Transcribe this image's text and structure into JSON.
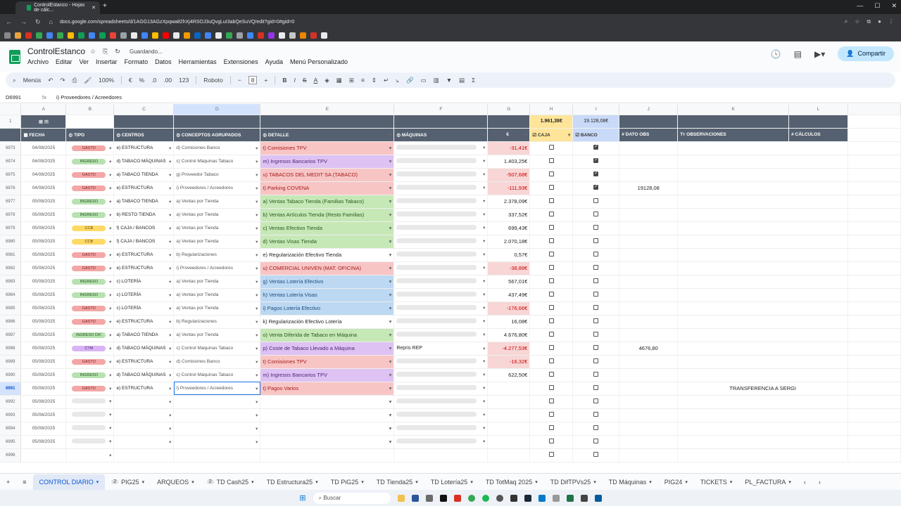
{
  "browser": {
    "tab_title": "ControlEstanco - Hojas de cálc...",
    "url": "docs.google.com/spreadsheets/d/1AGG13AGzXpqwa82hXj4RSOJ3uQvgLuI3abQeSuVQ/edit?gid=0#gid=0"
  },
  "doc": {
    "title": "ControlEstanco",
    "saving": "Guardando...",
    "menu": [
      "Archivo",
      "Editar",
      "Ver",
      "Insertar",
      "Formato",
      "Datos",
      "Herramientas",
      "Extensiones",
      "Ayuda",
      "Menú Personalizado"
    ],
    "share": "Compartir"
  },
  "toolbar": {
    "menus": "Menús",
    "zoom": "100%",
    "currency": "€",
    "percent": "%",
    "dec_less": ".0",
    "dec_more": ".00",
    "num": "123",
    "font": "Roboto",
    "font_size": "8",
    "sigma": "Σ"
  },
  "formula": {
    "ref": "D6991",
    "value": "i) Proveedores / Acreedores"
  },
  "columns": [
    "A",
    "B",
    "C",
    "D",
    "E",
    "F",
    "G",
    "H",
    "I",
    "J",
    "K",
    "L"
  ],
  "totals": {
    "caja": "1.961,38€",
    "banco": "19.128,08€"
  },
  "headers": {
    "fecha": "FECHA",
    "tipo": "TIPO",
    "centros": "CENTROS",
    "conceptos": "CONCEPTOS AGRUPADOS",
    "detalle": "DETALLE",
    "maquinas": "MÁQUINAS",
    "euro": "€",
    "caja": "CAJA",
    "banco": "BANCO",
    "dato_obs": "DATO OBS",
    "observaciones": "OBSERVACIONES",
    "calculos": "CÁLCULOS"
  },
  "rows": [
    {
      "n": "6973",
      "fecha": "04/08/2025",
      "tipo": "GASTO",
      "tc": "gasto",
      "centro": "e) ESTRUCTURA",
      "concepto": "d) Comisiones Banco",
      "detalle": "t) Comisiones TPV",
      "dc": "det-red",
      "maq": "",
      "euro": "-31,41€",
      "neg": true,
      "caja": false,
      "banco": true,
      "obs": "",
      "dato": ""
    },
    {
      "n": "6974",
      "fecha": "04/08/2025",
      "tipo": "INGRESO",
      "tc": "ingreso",
      "centro": "d) TABACO MÁQUINAS",
      "concepto": "c) Control Máquinas Tabaco",
      "detalle": "m) Ingresos Bancarios TPV",
      "dc": "det-purple",
      "maq": "",
      "euro": "1.403,25€",
      "neg": false,
      "caja": false,
      "banco": true,
      "obs": "",
      "dato": ""
    },
    {
      "n": "6975",
      "fecha": "04/08/2025",
      "tipo": "GASTO",
      "tc": "gasto",
      "centro": "a) TABACO TIENDA",
      "concepto": "g) Proveedor Tabaco",
      "detalle": "u) TABACOS DEL MEDIT SA (TABACO)",
      "dc": "det-red",
      "maq": "",
      "euro": "-507,68€",
      "neg": true,
      "caja": false,
      "banco": true,
      "obs": "",
      "dato": ""
    },
    {
      "n": "6976",
      "fecha": "04/08/2025",
      "tipo": "GASTO",
      "tc": "gasto",
      "centro": "e) ESTRUCTURA",
      "concepto": "i) Proveedores / Acreedores",
      "detalle": "t) Parking COVENA",
      "dc": "det-red",
      "maq": "",
      "euro": "-111,93€",
      "neg": true,
      "caja": false,
      "banco": true,
      "obs": "",
      "dato": "19128,08"
    },
    {
      "n": "6977",
      "fecha": "05/08/2025",
      "tipo": "INGRESO",
      "tc": "ingreso",
      "centro": "a) TABACO TIENDA",
      "concepto": "a) Ventas por Tienda",
      "detalle": "a) Ventas Tabaco Tienda (Familias Tabaco)",
      "dc": "det-green",
      "maq": "",
      "euro": "2.378,09€",
      "neg": false,
      "caja": false,
      "banco": false,
      "obs": "",
      "dato": ""
    },
    {
      "n": "6978",
      "fecha": "05/08/2025",
      "tipo": "INGRESO",
      "tc": "ingreso",
      "centro": "b) RESTO TIENDA",
      "concepto": "a) Ventas por Tienda",
      "detalle": "b) Ventas Artículos Tienda (Resto Familias)",
      "dc": "det-green",
      "maq": "",
      "euro": "337,52€",
      "neg": false,
      "caja": false,
      "banco": false,
      "obs": "",
      "dato": ""
    },
    {
      "n": "6979",
      "fecha": "05/08/2025",
      "tipo": "CCB",
      "tc": "ccb",
      "centro": "f) CAJA / BANCOS",
      "concepto": "a) Ventas por Tienda",
      "detalle": "c) Ventas Efectivo Tienda",
      "dc": "det-green",
      "maq": "",
      "euro": "699,43€",
      "neg": false,
      "caja": false,
      "banco": false,
      "obs": "",
      "dato": ""
    },
    {
      "n": "6980",
      "fecha": "05/08/2025",
      "tipo": "CCB",
      "tc": "ccb",
      "centro": "f) CAJA / BANCOS",
      "concepto": "a) Ventas por Tienda",
      "detalle": "d) Ventas Visas Tienda",
      "dc": "det-green",
      "maq": "",
      "euro": "2.070,18€",
      "neg": false,
      "caja": false,
      "banco": false,
      "obs": "",
      "dato": ""
    },
    {
      "n": "6981",
      "fecha": "05/08/2025",
      "tipo": "GASTO",
      "tc": "gasto",
      "centro": "e) ESTRUCTURA",
      "concepto": "b) Regularizaciones",
      "detalle": "e) Regularización Efectivo Tienda",
      "dc": "",
      "maq": "",
      "euro": "0,57€",
      "neg": false,
      "caja": false,
      "banco": false,
      "obs": "",
      "dato": ""
    },
    {
      "n": "6982",
      "fecha": "05/08/2025",
      "tipo": "GASTO",
      "tc": "gasto",
      "centro": "e) ESTRUCTURA",
      "concepto": "i) Proveedores / Acreedores",
      "detalle": "u) COMERCIAL UNIVEN (MAT. OFICINA)",
      "dc": "det-red",
      "maq": "",
      "euro": "-38,88€",
      "neg": true,
      "caja": false,
      "banco": false,
      "obs": "",
      "dato": ""
    },
    {
      "n": "6983",
      "fecha": "05/08/2025",
      "tipo": "INGRESO",
      "tc": "ingreso",
      "centro": "c) LOTERÍA",
      "concepto": "a) Ventas por Tienda",
      "detalle": "g) Ventas Lotería Efectivo",
      "dc": "det-blue",
      "maq": "",
      "euro": "567,01€",
      "neg": false,
      "caja": false,
      "banco": false,
      "obs": "",
      "dato": ""
    },
    {
      "n": "6984",
      "fecha": "05/08/2025",
      "tipo": "INGRESO",
      "tc": "ingreso",
      "centro": "c) LOTERÍA",
      "concepto": "a) Ventas por Tienda",
      "detalle": "h) Ventas Lotería Visas",
      "dc": "det-blue",
      "maq": "",
      "euro": "437,49€",
      "neg": false,
      "caja": false,
      "banco": false,
      "obs": "",
      "dato": ""
    },
    {
      "n": "6985",
      "fecha": "05/08/2025",
      "tipo": "GASTO",
      "tc": "gasto",
      "centro": "c) LOTERÍA",
      "concepto": "a) Ventas por Tienda",
      "detalle": "i) Pagos Lotería Efectivo",
      "dc": "det-blue",
      "maq": "",
      "euro": "-176,66€",
      "neg": true,
      "caja": false,
      "banco": false,
      "obs": "",
      "dato": ""
    },
    {
      "n": "6986",
      "fecha": "05/08/2025",
      "tipo": "GASTO",
      "tc": "gasto",
      "centro": "e) ESTRUCTURA",
      "concepto": "b) Regularizaciones",
      "detalle": "k) Regularización Efectivo Lotería",
      "dc": "",
      "maq": "",
      "euro": "16,08€",
      "neg": false,
      "caja": false,
      "banco": false,
      "obs": "",
      "dato": ""
    },
    {
      "n": "6987",
      "fecha": "05/08/2025",
      "tipo": "INGRESO DIF.",
      "tc": "ingreso",
      "centro": "a) TABACO TIENDA",
      "concepto": "a) Ventas por Tienda",
      "detalle": "o) Venta Diferida de Tabaco en Máquina",
      "dc": "det-green",
      "maq": "",
      "euro": "4.676,80€",
      "neg": false,
      "caja": false,
      "banco": false,
      "obs": "",
      "dato": ""
    },
    {
      "n": "6988",
      "fecha": "05/08/2025",
      "tipo": "CTM",
      "tc": "ctm",
      "centro": "d) TABACO MÁQUINAS",
      "concepto": "c) Control Máquinas Tabaco",
      "detalle": "p) Coste de Tabaco Llevado a Máquina",
      "dc": "det-purple",
      "maq": "Repris REP",
      "euro": "-4.277,53€",
      "neg": true,
      "caja": false,
      "banco": false,
      "obs": "",
      "dato": "4676,80"
    },
    {
      "n": "6989",
      "fecha": "05/08/2025",
      "tipo": "GASTO",
      "tc": "gasto",
      "centro": "e) ESTRUCTURA",
      "concepto": "d) Comisiones Banco",
      "detalle": "t) Comisiones TPV",
      "dc": "det-red",
      "maq": "",
      "euro": "-16,32€",
      "neg": true,
      "caja": false,
      "banco": false,
      "obs": "",
      "dato": ""
    },
    {
      "n": "6990",
      "fecha": "05/08/2025",
      "tipo": "INGRESO",
      "tc": "ingreso",
      "centro": "d) TABACO MÁQUINAS",
      "concepto": "c) Control Máquinas Tabaco",
      "detalle": "m) Ingresos Bancarios TPV",
      "dc": "det-purple",
      "maq": "",
      "euro": "622,50€",
      "neg": false,
      "caja": false,
      "banco": false,
      "obs": "",
      "dato": ""
    },
    {
      "n": "6991",
      "fecha": "05/08/2025",
      "tipo": "GASTO",
      "tc": "gasto",
      "centro": "e) ESTRUCTURA",
      "concepto": "i) Proveedores / Acreedores",
      "detalle": "t) Pagos Varios",
      "dc": "det-red",
      "maq": "",
      "euro": "",
      "neg": false,
      "caja": false,
      "banco": false,
      "obs": "TRANSFERENCIA A SERGI",
      "dato": ""
    },
    {
      "n": "6992",
      "fecha": "05/08/2025",
      "tipo": "",
      "tc": "",
      "centro": "",
      "concepto": "",
      "detalle": "",
      "dc": "",
      "maq": "",
      "euro": "",
      "neg": false,
      "caja": false,
      "banco": false,
      "obs": "",
      "dato": ""
    },
    {
      "n": "6993",
      "fecha": "05/08/2025",
      "tipo": "",
      "tc": "",
      "centro": "",
      "concepto": "",
      "detalle": "",
      "dc": "",
      "maq": "",
      "euro": "",
      "neg": false,
      "caja": false,
      "banco": false,
      "obs": "",
      "dato": ""
    },
    {
      "n": "6994",
      "fecha": "05/08/2025",
      "tipo": "",
      "tc": "",
      "centro": "",
      "concepto": "",
      "detalle": "",
      "dc": "",
      "maq": "",
      "euro": "",
      "neg": false,
      "caja": false,
      "banco": false,
      "obs": "",
      "dato": ""
    },
    {
      "n": "6995",
      "fecha": "05/08/2025",
      "tipo": "",
      "tc": "",
      "centro": "",
      "concepto": "",
      "detalle": "",
      "dc": "",
      "maq": "",
      "euro": "",
      "neg": false,
      "caja": false,
      "banco": false,
      "obs": "",
      "dato": ""
    },
    {
      "n": "6996",
      "fecha": "",
      "tipo": "",
      "tc": "",
      "centro": "",
      "concepto": "",
      "detalle": "",
      "dc": "",
      "maq": "",
      "euro": "",
      "neg": false,
      "caja": false,
      "banco": false,
      "obs": "",
      "dato": ""
    }
  ],
  "sheets": [
    {
      "name": "CONTROL DIARIO",
      "active": true,
      "badge": ""
    },
    {
      "name": "PIG25",
      "active": false,
      "badge": "2"
    },
    {
      "name": "ARQUEOS",
      "active": false,
      "badge": ""
    },
    {
      "name": "TD Cash25",
      "active": false,
      "badge": "2"
    },
    {
      "name": "TD Estructura25",
      "active": false,
      "badge": ""
    },
    {
      "name": "TD PiG25",
      "active": false,
      "badge": ""
    },
    {
      "name": "TD Tienda25",
      "active": false,
      "badge": ""
    },
    {
      "name": "TD Lotería25",
      "active": false,
      "badge": ""
    },
    {
      "name": "TD TotMaq 2025",
      "active": false,
      "badge": ""
    },
    {
      "name": "TD DifTPVs25",
      "active": false,
      "badge": ""
    },
    {
      "name": "TD Máquinas",
      "active": false,
      "badge": ""
    },
    {
      "name": "PIG24",
      "active": false,
      "badge": ""
    },
    {
      "name": "TICKETS",
      "active": false,
      "badge": ""
    },
    {
      "name": "PL_FACTURA",
      "active": false,
      "badge": ""
    }
  ],
  "taskbar": {
    "search": "Buscar"
  }
}
